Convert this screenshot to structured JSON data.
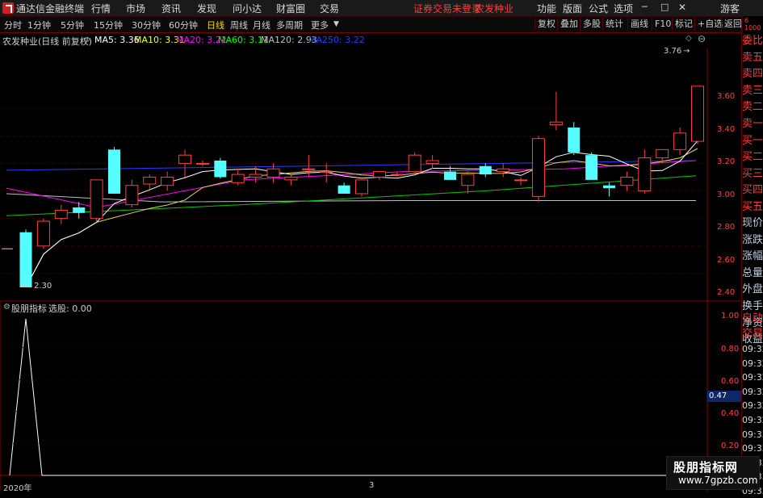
{
  "app": {
    "title": "通达信金融终端",
    "menu": [
      "行情",
      "市场",
      "资讯",
      "发现",
      "问小达",
      "财富圈",
      "交易"
    ],
    "notice": "证券交易未登录",
    "stock": "农发种业",
    "right_menu": [
      "功能",
      "版面",
      "公式",
      "选项"
    ],
    "user": "游客"
  },
  "periods": [
    "分时",
    "1分钟",
    "5分钟",
    "15分钟",
    "30分钟",
    "60分钟",
    "日线",
    "周线",
    "月线",
    "多周期",
    "更多"
  ],
  "active_period": "日线",
  "toolbar_right": [
    "复权",
    "叠加",
    "多股",
    "统计",
    "画线",
    "F10",
    "标记",
    "+自选",
    "返回"
  ],
  "info": {
    "name": "农发种业(日线 前复权)",
    "ma": [
      {
        "label": "MA5: 3.36",
        "color": "#ffffff"
      },
      {
        "label": "MA10: 3.31",
        "color": "#ffff00"
      },
      {
        "label": "MA20: 3.22",
        "color": "#ff00ff"
      },
      {
        "label": "MA60: 3.11",
        "color": "#00ff00"
      },
      {
        "label": "MA120: 2.93",
        "color": "#c0c0c0"
      },
      {
        "label": "MA250: 3.22",
        "color": "#2040ff"
      }
    ]
  },
  "price_axis": [
    "3.60",
    "3.40",
    "3.20",
    "3.00",
    "2.80",
    "2.60",
    "2.40"
  ],
  "annotations": {
    "high": "3.76",
    "low": "2.30"
  },
  "indicator": {
    "name": "股朋指标",
    "value": "选股: 0.00"
  },
  "ind_axis": [
    "1.00",
    "0.80",
    "0.60",
    "0.47",
    "0.40",
    "0.20"
  ],
  "right_panel": [
    "委比",
    "卖五",
    "卖四",
    "卖三",
    "卖二",
    "卖一",
    "买一",
    "买二",
    "买三",
    "买四",
    "买五",
    "现价",
    "涨跌",
    "涨幅",
    "总量",
    "外盘",
    "换手",
    "净资",
    "收益"
  ],
  "right_panel2": [
    "自动",
    "交易",
    "09:32",
    "09:32",
    "09:32",
    "09:32",
    "09:32",
    "09:32",
    "09:33",
    "09:33",
    "09:33",
    "09:33",
    "09:33"
  ],
  "bottom": {
    "year": "2020年",
    "month": "3"
  },
  "watermark": {
    "title": "股朋指标网",
    "url": "www.7gpzb.com"
  },
  "chart_data": {
    "type": "candlestick",
    "y_range": [
      2.3,
      3.8
    ],
    "candles": [
      {
        "o": 2.7,
        "h": 2.72,
        "l": 2.3,
        "c": 2.3
      },
      {
        "o": 2.6,
        "h": 2.8,
        "l": 2.58,
        "c": 2.78
      },
      {
        "o": 2.8,
        "h": 2.9,
        "l": 2.76,
        "c": 2.86
      },
      {
        "o": 2.88,
        "h": 2.92,
        "l": 2.8,
        "c": 2.84
      },
      {
        "o": 2.8,
        "h": 3.08,
        "l": 2.78,
        "c": 3.08
      },
      {
        "o": 3.3,
        "h": 3.32,
        "l": 2.98,
        "c": 2.98
      },
      {
        "o": 2.9,
        "h": 3.08,
        "l": 2.88,
        "c": 3.04
      },
      {
        "o": 3.05,
        "h": 3.12,
        "l": 3.0,
        "c": 3.1
      },
      {
        "o": 3.04,
        "h": 3.14,
        "l": 3.0,
        "c": 3.1
      },
      {
        "o": 3.2,
        "h": 3.3,
        "l": 3.1,
        "c": 3.26
      },
      {
        "o": 3.2,
        "h": 3.22,
        "l": 3.18,
        "c": 3.2
      },
      {
        "o": 3.22,
        "h": 3.24,
        "l": 3.09,
        "c": 3.1
      },
      {
        "o": 3.06,
        "h": 3.16,
        "l": 3.04,
        "c": 3.12
      },
      {
        "o": 3.1,
        "h": 3.18,
        "l": 3.06,
        "c": 3.12
      },
      {
        "o": 3.1,
        "h": 3.2,
        "l": 3.06,
        "c": 3.16
      },
      {
        "o": 3.08,
        "h": 3.12,
        "l": 3.04,
        "c": 3.1
      },
      {
        "o": 3.16,
        "h": 3.26,
        "l": 3.1,
        "c": 3.16
      },
      {
        "o": 3.14,
        "h": 3.2,
        "l": 3.06,
        "c": 3.14
      },
      {
        "o": 3.04,
        "h": 3.06,
        "l": 2.98,
        "c": 2.98
      },
      {
        "o": 2.98,
        "h": 3.08,
        "l": 2.96,
        "c": 3.08
      },
      {
        "o": 3.1,
        "h": 3.14,
        "l": 3.08,
        "c": 3.14
      },
      {
        "o": 3.12,
        "h": 3.14,
        "l": 3.1,
        "c": 3.12
      },
      {
        "o": 3.14,
        "h": 3.28,
        "l": 3.12,
        "c": 3.26
      },
      {
        "o": 3.2,
        "h": 3.26,
        "l": 3.16,
        "c": 3.22
      },
      {
        "o": 3.14,
        "h": 3.18,
        "l": 3.08,
        "c": 3.08
      },
      {
        "o": 3.04,
        "h": 3.14,
        "l": 2.98,
        "c": 3.12
      },
      {
        "o": 3.18,
        "h": 3.2,
        "l": 3.1,
        "c": 3.12
      },
      {
        "o": 3.14,
        "h": 3.2,
        "l": 3.1,
        "c": 3.16
      },
      {
        "o": 3.08,
        "h": 3.1,
        "l": 3.04,
        "c": 3.08
      },
      {
        "o": 2.96,
        "h": 3.4,
        "l": 2.92,
        "c": 3.38
      },
      {
        "o": 3.48,
        "h": 3.72,
        "l": 3.44,
        "c": 3.5
      },
      {
        "o": 3.46,
        "h": 3.5,
        "l": 3.26,
        "c": 3.28
      },
      {
        "o": 3.26,
        "h": 3.28,
        "l": 3.08,
        "c": 3.08
      },
      {
        "o": 3.04,
        "h": 3.06,
        "l": 2.96,
        "c": 3.02
      },
      {
        "o": 3.04,
        "h": 3.14,
        "l": 3.0,
        "c": 3.1
      },
      {
        "o": 3.0,
        "h": 3.3,
        "l": 2.98,
        "c": 3.24
      },
      {
        "o": 3.24,
        "h": 3.3,
        "l": 3.2,
        "c": 3.3
      },
      {
        "o": 3.3,
        "h": 3.46,
        "l": 3.26,
        "c": 3.42
      },
      {
        "o": 3.36,
        "h": 3.76,
        "l": 3.34,
        "c": 3.76
      }
    ]
  }
}
